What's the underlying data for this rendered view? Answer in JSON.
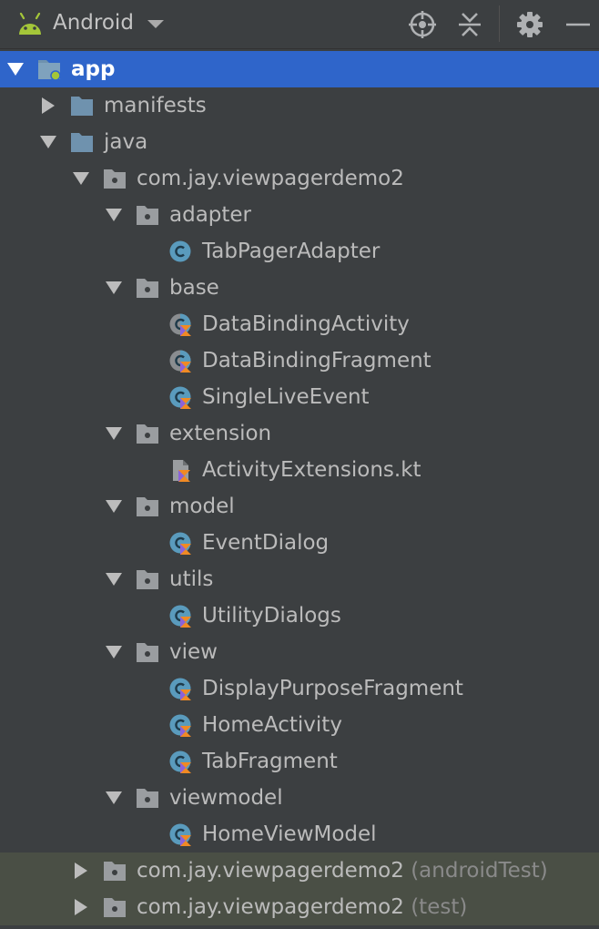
{
  "toolbar": {
    "title": "Android",
    "icons": [
      "android-icon",
      "locate-icon",
      "collapse-all-icon",
      "gear-icon",
      "hide-icon"
    ]
  },
  "tree": [
    {
      "label": "app",
      "suffix": "",
      "level": 0,
      "expand": "down",
      "icon": "module",
      "selected": true
    },
    {
      "label": "manifests",
      "suffix": "",
      "level": 1,
      "expand": "right",
      "icon": "folder"
    },
    {
      "label": "java",
      "suffix": "",
      "level": 1,
      "expand": "down",
      "icon": "folder"
    },
    {
      "label": "com.jay.viewpagerdemo2",
      "suffix": "",
      "level": 2,
      "expand": "down",
      "icon": "package"
    },
    {
      "label": "adapter",
      "suffix": "",
      "level": 3,
      "expand": "down",
      "icon": "package"
    },
    {
      "label": "TabPagerAdapter",
      "suffix": "",
      "level": 4,
      "expand": "none",
      "icon": "class"
    },
    {
      "label": "base",
      "suffix": "",
      "level": 3,
      "expand": "down",
      "icon": "package"
    },
    {
      "label": "DataBindingActivity",
      "suffix": "",
      "level": 4,
      "expand": "none",
      "icon": "kotlin-abstract"
    },
    {
      "label": "DataBindingFragment",
      "suffix": "",
      "level": 4,
      "expand": "none",
      "icon": "kotlin-abstract"
    },
    {
      "label": "SingleLiveEvent",
      "suffix": "",
      "level": 4,
      "expand": "none",
      "icon": "kotlin-class"
    },
    {
      "label": "extension",
      "suffix": "",
      "level": 3,
      "expand": "down",
      "icon": "package"
    },
    {
      "label": "ActivityExtensions.kt",
      "suffix": "",
      "level": 4,
      "expand": "none",
      "icon": "kotlin-file"
    },
    {
      "label": "model",
      "suffix": "",
      "level": 3,
      "expand": "down",
      "icon": "package"
    },
    {
      "label": "EventDialog",
      "suffix": "",
      "level": 4,
      "expand": "none",
      "icon": "kotlin-class"
    },
    {
      "label": "utils",
      "suffix": "",
      "level": 3,
      "expand": "down",
      "icon": "package"
    },
    {
      "label": "UtilityDialogs",
      "suffix": "",
      "level": 4,
      "expand": "none",
      "icon": "kotlin-class"
    },
    {
      "label": "view",
      "suffix": "",
      "level": 3,
      "expand": "down",
      "icon": "package"
    },
    {
      "label": "DisplayPurposeFragment",
      "suffix": "",
      "level": 4,
      "expand": "none",
      "icon": "kotlin-class"
    },
    {
      "label": "HomeActivity",
      "suffix": "",
      "level": 4,
      "expand": "none",
      "icon": "kotlin-class"
    },
    {
      "label": "TabFragment",
      "suffix": "",
      "level": 4,
      "expand": "none",
      "icon": "kotlin-class"
    },
    {
      "label": "viewmodel",
      "suffix": "",
      "level": 3,
      "expand": "down",
      "icon": "package"
    },
    {
      "label": "HomeViewModel",
      "suffix": "",
      "level": 4,
      "expand": "none",
      "icon": "kotlin-class"
    },
    {
      "label": "com.jay.viewpagerdemo2",
      "suffix": "(androidTest)",
      "level": 2,
      "expand": "right",
      "icon": "package",
      "tinted": true
    },
    {
      "label": "com.jay.viewpagerdemo2",
      "suffix": "(test)",
      "level": 2,
      "expand": "right",
      "icon": "package",
      "tinted": true
    }
  ],
  "colors": {
    "selection": "#2f65ca",
    "test_row": "#4a4f45",
    "folder": "#6f92ae",
    "class_icon": "#5a9bbd",
    "kotlin_orange": "#f08a24",
    "kotlin_purple": "#8b63d9",
    "android_green": "#a4c639"
  }
}
